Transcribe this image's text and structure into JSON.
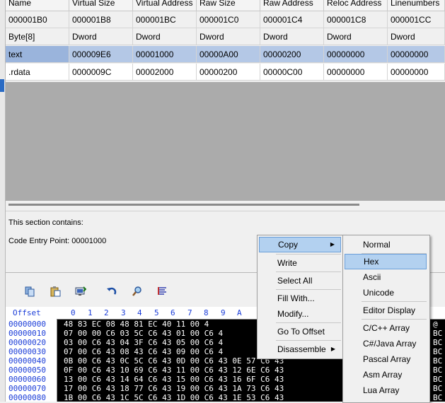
{
  "table": {
    "headers": [
      "Name",
      "Virtual Size",
      "Virtual Address",
      "Raw Size",
      "Raw Address",
      "Reloc Address",
      "Linenumbers"
    ],
    "offsets": [
      "000001B0",
      "000001B8",
      "000001BC",
      "000001C0",
      "000001C4",
      "000001C8",
      "000001CC"
    ],
    "types": [
      "Byte[8]",
      "Dword",
      "Dword",
      "Dword",
      "Dword",
      "Dword",
      "Dword"
    ],
    "rows": [
      [
        "text",
        "000009E6",
        "00001000",
        "00000A00",
        "00000200",
        "00000000",
        "00000000"
      ],
      [
        ".rdata",
        "0000009C",
        "00002000",
        "00000200",
        "00000C00",
        "00000000",
        "00000000"
      ]
    ]
  },
  "info": {
    "contains": "This section contains:",
    "entry_point": "Code Entry Point: 00001000"
  },
  "hex": {
    "header_label": "Offset",
    "columns": [
      "0",
      "1",
      "2",
      "3",
      "4",
      "5",
      "6",
      "7",
      "8",
      "9",
      "A"
    ],
    "offsets": [
      "00000000",
      "00000010",
      "00000020",
      "00000030",
      "00000040",
      "00000050",
      "00000060",
      "00000070",
      "00000080"
    ],
    "rows": [
      "48 83 EC 08 48 81 EC 40 11 00 4",
      "07 00 00 C6 03 5C C6 43 01 00 C6 4",
      "03 00 C6 43 04 3F C6 43 05 00 C6 4",
      "07 00 C6 43 08 43 C6 43 09 00 C6 4",
      "0B 00 C6 43 0C 5C C6 43 0D 00 C6 43 0E 57 C6 43",
      "0F 00 C6 43 10 69 C6 43 11 00 C6 43 12 6E C6 43",
      "13 00 C6 43 14 64 C6 43 15 00 C6 43 16 6F C6 43",
      "17 00 C6 43 18 77 C6 43 19 00 C6 43 1A 73 C6 43",
      "1B 00 C6 43 1C 5C C6 43 1D 00 C6 43 1E 53 C6 43"
    ],
    "ascii": [
      "@",
      "BC",
      "BC",
      "BC",
      "BC",
      "BC",
      "BC",
      "BC",
      "BC"
    ]
  },
  "context_menu": {
    "items": [
      "Copy",
      "Write",
      "Select All",
      "Fill With...",
      "Modify...",
      "Go To Offset",
      "Disassemble"
    ]
  },
  "copy_submenu": {
    "items": [
      "Normal",
      "Hex",
      "Ascii",
      "Unicode",
      "Editor Display",
      "C/C++ Array",
      "C#/Java Array",
      "Pascal Array",
      "Asm Array",
      "Lua Array"
    ]
  },
  "colors": {
    "selection": "#b4c8e6",
    "menu_highlight": "#b3d1f0",
    "hex_offset": "#1a3cd8"
  }
}
